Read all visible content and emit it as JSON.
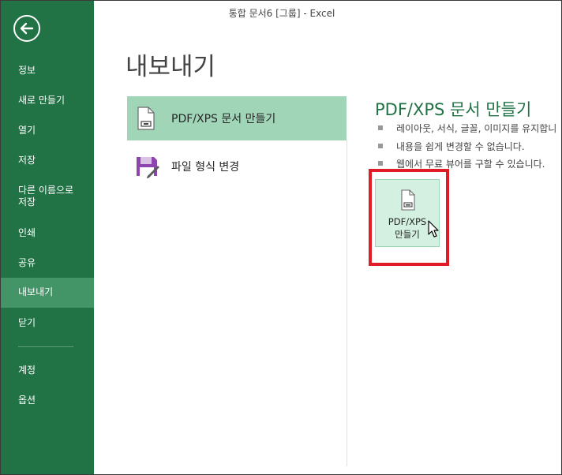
{
  "window": {
    "title": "통합 문서6  [그룹] - Excel"
  },
  "sidebar": {
    "items": [
      {
        "label": "정보"
      },
      {
        "label": "새로 만들기"
      },
      {
        "label": "열기"
      },
      {
        "label": "저장"
      },
      {
        "label": "다른 이름으로\n저장"
      },
      {
        "label": "인쇄"
      },
      {
        "label": "공유"
      },
      {
        "label": "내보내기",
        "active": true
      },
      {
        "label": "닫기"
      },
      {
        "label": "계정"
      },
      {
        "label": "옵션"
      }
    ]
  },
  "main": {
    "title": "내보내기",
    "options": [
      {
        "label": "PDF/XPS 문서 만들기",
        "icon": "pdf-document-icon",
        "selected": true
      },
      {
        "label": "파일 형식 변경",
        "icon": "save-disk-icon",
        "selected": false
      }
    ],
    "detail": {
      "title": "PDF/XPS 문서 만들기",
      "bullets": [
        "레이아웃, 서식, 글꼴, 이미지를 유지합니",
        "내용을 쉽게 변경할 수 없습니다.",
        "웹에서 무료 뷰어를 구할 수 있습니다."
      ],
      "button_label_line1": "PDF/XPS",
      "button_label_line2": "만들기"
    }
  },
  "colors": {
    "sidebar": "#217346",
    "active": "#439467",
    "selected_option": "#a0d5b8",
    "highlight": "#e01c24"
  }
}
